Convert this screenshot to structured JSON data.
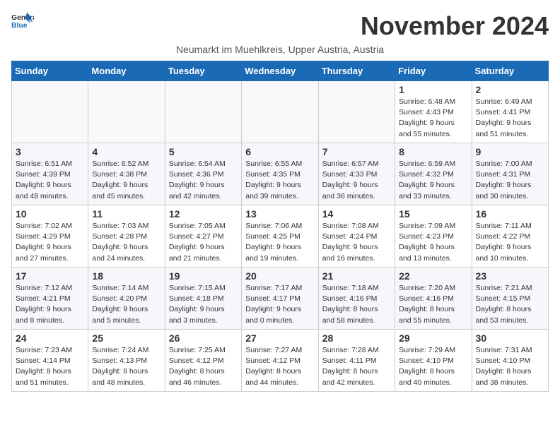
{
  "logo": {
    "general": "General",
    "blue": "Blue"
  },
  "title": "November 2024",
  "location": "Neumarkt im Muehlkreis, Upper Austria, Austria",
  "days_of_week": [
    "Sunday",
    "Monday",
    "Tuesday",
    "Wednesday",
    "Thursday",
    "Friday",
    "Saturday"
  ],
  "weeks": [
    [
      {
        "day": "",
        "info": ""
      },
      {
        "day": "",
        "info": ""
      },
      {
        "day": "",
        "info": ""
      },
      {
        "day": "",
        "info": ""
      },
      {
        "day": "",
        "info": ""
      },
      {
        "day": "1",
        "info": "Sunrise: 6:48 AM\nSunset: 4:43 PM\nDaylight: 9 hours\nand 55 minutes."
      },
      {
        "day": "2",
        "info": "Sunrise: 6:49 AM\nSunset: 4:41 PM\nDaylight: 9 hours\nand 51 minutes."
      }
    ],
    [
      {
        "day": "3",
        "info": "Sunrise: 6:51 AM\nSunset: 4:39 PM\nDaylight: 9 hours\nand 48 minutes."
      },
      {
        "day": "4",
        "info": "Sunrise: 6:52 AM\nSunset: 4:38 PM\nDaylight: 9 hours\nand 45 minutes."
      },
      {
        "day": "5",
        "info": "Sunrise: 6:54 AM\nSunset: 4:36 PM\nDaylight: 9 hours\nand 42 minutes."
      },
      {
        "day": "6",
        "info": "Sunrise: 6:55 AM\nSunset: 4:35 PM\nDaylight: 9 hours\nand 39 minutes."
      },
      {
        "day": "7",
        "info": "Sunrise: 6:57 AM\nSunset: 4:33 PM\nDaylight: 9 hours\nand 36 minutes."
      },
      {
        "day": "8",
        "info": "Sunrise: 6:59 AM\nSunset: 4:32 PM\nDaylight: 9 hours\nand 33 minutes."
      },
      {
        "day": "9",
        "info": "Sunrise: 7:00 AM\nSunset: 4:31 PM\nDaylight: 9 hours\nand 30 minutes."
      }
    ],
    [
      {
        "day": "10",
        "info": "Sunrise: 7:02 AM\nSunset: 4:29 PM\nDaylight: 9 hours\nand 27 minutes."
      },
      {
        "day": "11",
        "info": "Sunrise: 7:03 AM\nSunset: 4:28 PM\nDaylight: 9 hours\nand 24 minutes."
      },
      {
        "day": "12",
        "info": "Sunrise: 7:05 AM\nSunset: 4:27 PM\nDaylight: 9 hours\nand 21 minutes."
      },
      {
        "day": "13",
        "info": "Sunrise: 7:06 AM\nSunset: 4:25 PM\nDaylight: 9 hours\nand 19 minutes."
      },
      {
        "day": "14",
        "info": "Sunrise: 7:08 AM\nSunset: 4:24 PM\nDaylight: 9 hours\nand 16 minutes."
      },
      {
        "day": "15",
        "info": "Sunrise: 7:09 AM\nSunset: 4:23 PM\nDaylight: 9 hours\nand 13 minutes."
      },
      {
        "day": "16",
        "info": "Sunrise: 7:11 AM\nSunset: 4:22 PM\nDaylight: 9 hours\nand 10 minutes."
      }
    ],
    [
      {
        "day": "17",
        "info": "Sunrise: 7:12 AM\nSunset: 4:21 PM\nDaylight: 9 hours\nand 8 minutes."
      },
      {
        "day": "18",
        "info": "Sunrise: 7:14 AM\nSunset: 4:20 PM\nDaylight: 9 hours\nand 5 minutes."
      },
      {
        "day": "19",
        "info": "Sunrise: 7:15 AM\nSunset: 4:18 PM\nDaylight: 9 hours\nand 3 minutes."
      },
      {
        "day": "20",
        "info": "Sunrise: 7:17 AM\nSunset: 4:17 PM\nDaylight: 9 hours\nand 0 minutes."
      },
      {
        "day": "21",
        "info": "Sunrise: 7:18 AM\nSunset: 4:16 PM\nDaylight: 8 hours\nand 58 minutes."
      },
      {
        "day": "22",
        "info": "Sunrise: 7:20 AM\nSunset: 4:16 PM\nDaylight: 8 hours\nand 55 minutes."
      },
      {
        "day": "23",
        "info": "Sunrise: 7:21 AM\nSunset: 4:15 PM\nDaylight: 8 hours\nand 53 minutes."
      }
    ],
    [
      {
        "day": "24",
        "info": "Sunrise: 7:23 AM\nSunset: 4:14 PM\nDaylight: 8 hours\nand 51 minutes."
      },
      {
        "day": "25",
        "info": "Sunrise: 7:24 AM\nSunset: 4:13 PM\nDaylight: 8 hours\nand 48 minutes."
      },
      {
        "day": "26",
        "info": "Sunrise: 7:25 AM\nSunset: 4:12 PM\nDaylight: 8 hours\nand 46 minutes."
      },
      {
        "day": "27",
        "info": "Sunrise: 7:27 AM\nSunset: 4:12 PM\nDaylight: 8 hours\nand 44 minutes."
      },
      {
        "day": "28",
        "info": "Sunrise: 7:28 AM\nSunset: 4:11 PM\nDaylight: 8 hours\nand 42 minutes."
      },
      {
        "day": "29",
        "info": "Sunrise: 7:29 AM\nSunset: 4:10 PM\nDaylight: 8 hours\nand 40 minutes."
      },
      {
        "day": "30",
        "info": "Sunrise: 7:31 AM\nSunset: 4:10 PM\nDaylight: 8 hours\nand 38 minutes."
      }
    ]
  ]
}
